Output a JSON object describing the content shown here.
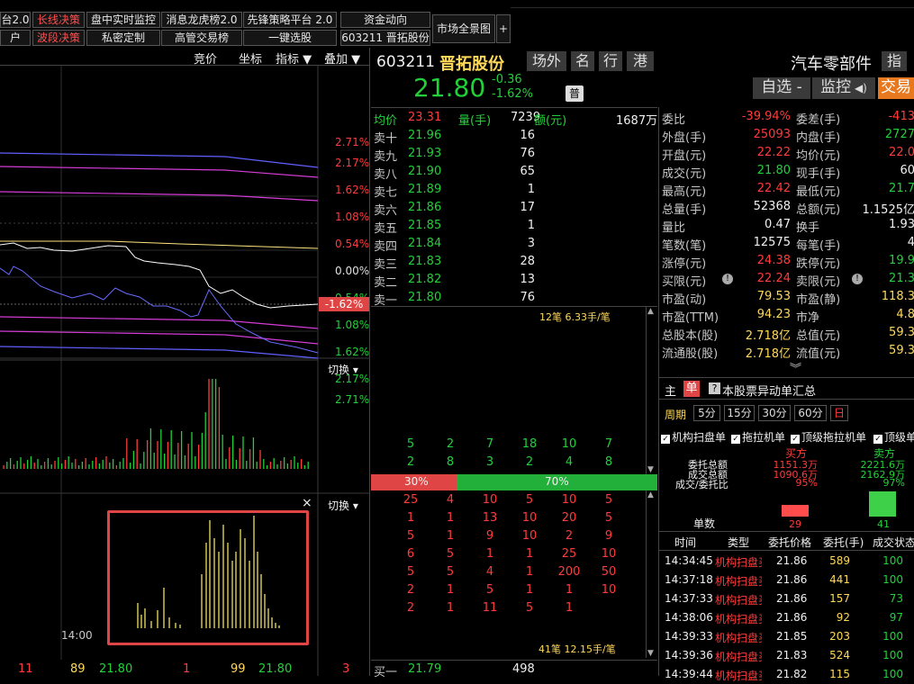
{
  "toolbar": {
    "row1": [
      "台2.0",
      "长线决策",
      "盘中实时监控",
      "消息龙虎榜2.0",
      "先锋策略平台 2.0",
      "资金动向"
    ],
    "row2": [
      "户",
      "波段决策",
      "私密定制",
      "高管交易榜",
      "一键选股",
      "603211 晋拓股份"
    ],
    "market": "市场全景图",
    "plus": "+"
  },
  "chart_tabs": [
    "竞价",
    "坐标",
    "指标 ▼",
    "叠加 ▼"
  ],
  "price_axis": [
    "2.71%",
    "2.17%",
    "1.62%",
    "1.08%",
    "0.54%",
    "0.00%",
    "0.54%",
    "1.08%",
    "1.62%",
    "2.17%",
    "2.71%"
  ],
  "current_tag": "-1.62%",
  "switch1": "切换 ▾",
  "switch2": "切换 ▾",
  "close_x": "×",
  "time_label": "14:00",
  "bottom_ticker": [
    "11",
    "89",
    "21.80",
    "1",
    "99",
    "21.80",
    "3"
  ],
  "header": {
    "code": "603211",
    "name": "晋拓股份",
    "tabs": [
      "场外",
      "名",
      "行",
      "港"
    ],
    "industry": "汽车零部件",
    "index_btn": "指",
    "price": "21.80",
    "change": "-0.36",
    "pct": "-1.62%",
    "badge": "普",
    "zixuan": "自选 -",
    "jiankong": "监控",
    "jiaoyi": "交易"
  },
  "avg": {
    "label": "均价",
    "value": "23.31",
    "vol_label": "量(手)",
    "vol": "7239",
    "amt_label": "额(元)",
    "amt": "1687万"
  },
  "asks": [
    [
      "卖十",
      "21.96",
      "16"
    ],
    [
      "卖九",
      "21.93",
      "76"
    ],
    [
      "卖八",
      "21.90",
      "65"
    ],
    [
      "卖七",
      "21.89",
      "1"
    ],
    [
      "卖六",
      "21.86",
      "17"
    ],
    [
      "卖五",
      "21.85",
      "1"
    ],
    [
      "卖四",
      "21.84",
      "3"
    ],
    [
      "卖三",
      "21.83",
      "28"
    ],
    [
      "卖二",
      "21.82",
      "13"
    ],
    [
      "卖一",
      "21.80",
      "76"
    ]
  ],
  "bid1": [
    "买一",
    "21.79",
    "498"
  ],
  "queue_top": "12笔 6.33手/笔",
  "queue_bottom": "41笔 12.15手/笔",
  "queue_sell": [
    [
      "5",
      "2",
      "7",
      "18",
      "10",
      "7"
    ],
    [
      "2",
      "8",
      "3",
      "2",
      "4",
      "8"
    ]
  ],
  "ratio": {
    "left": "30%",
    "right": "70%",
    "left_frac": 0.3
  },
  "queue_buy": [
    [
      "25",
      "4",
      "10",
      "5",
      "10",
      "5"
    ],
    [
      "1",
      "1",
      "13",
      "10",
      "20",
      "5"
    ],
    [
      "5",
      "1",
      "9",
      "10",
      "2",
      "9"
    ],
    [
      "6",
      "5",
      "1",
      "1",
      "25",
      "10"
    ],
    [
      "5",
      "5",
      "4",
      "1",
      "200",
      "50"
    ],
    [
      "2",
      "1",
      "5",
      "1",
      "1",
      "10"
    ],
    [
      "2",
      "1",
      "11",
      "5",
      "1",
      ""
    ]
  ],
  "stats": [
    [
      "委比",
      "-39.94%",
      "red",
      "委差(手)",
      "-413",
      "red"
    ],
    [
      "外盘(手)",
      "25093",
      "red",
      "内盘(手)",
      "2727",
      "green"
    ],
    [
      "开盘(元)",
      "22.22",
      "red",
      "均价(元)",
      "22.0",
      "red"
    ],
    [
      "成交(元)",
      "21.80",
      "green",
      "现手(手)",
      "60",
      "white"
    ],
    [
      "最高(元)",
      "22.42",
      "red",
      "最低(元)",
      "21.7",
      "green"
    ],
    [
      "总量(手)",
      "52368",
      "white",
      "总额(元)",
      "1.1525亿",
      "white"
    ],
    [
      "量比",
      "0.47",
      "white",
      "换手",
      "1.93",
      "white"
    ],
    [
      "笔数(笔)",
      "12575",
      "white",
      "每笔(手)",
      "4",
      "white"
    ],
    [
      "涨停(元)",
      "24.38",
      "red",
      "跌停(元)",
      "19.9",
      "green"
    ],
    [
      "买限(元)",
      "22.24",
      "red",
      "卖限(元)",
      "21.3",
      "green"
    ],
    [
      "市盈(动)",
      "79.53",
      "yellow",
      "市盈(静)",
      "118.3",
      "yellow"
    ],
    [
      "市盈(TTM)",
      "94.23",
      "yellow",
      "市净",
      "4.8",
      "yellow"
    ],
    [
      "总股本(股)",
      "2.718亿",
      "yellow",
      "总值(元)",
      "59.3",
      "yellow"
    ],
    [
      "流通股(股)",
      "2.718亿",
      "yellow",
      "流值(元)",
      "59.3",
      "yellow"
    ]
  ],
  "expand": "︾",
  "bottom_tabs": {
    "main": "主",
    "single": "单",
    "title": "本股票异动单汇总"
  },
  "period": {
    "label": "周期",
    "options": [
      "5分",
      "15分",
      "30分",
      "60分",
      "日"
    ]
  },
  "checks": [
    "机构扫盘单",
    "拖拉机单",
    "顶级拖拉机单",
    "顶级单"
  ],
  "summary": {
    "rows": [
      "委托总额",
      "成交总额",
      "成交/委托比"
    ],
    "buy_head": "买方",
    "sell_head": "卖方",
    "buy": [
      "1151.3万",
      "1090.6万",
      "95%"
    ],
    "sell": [
      "2221.6万",
      "2162.9万",
      "97%"
    ],
    "count_label": "单数",
    "buy_count": "29",
    "sell_count": "41",
    "buy_bar": 0.45,
    "sell_bar": 1.0
  },
  "trades_head": [
    "时间",
    "类型",
    "委托价格",
    "委托(手)",
    "成交状态"
  ],
  "trades": [
    [
      "14:34:45",
      "机构扫盘买",
      "21.86",
      "589",
      "100"
    ],
    [
      "14:37:18",
      "机构扫盘买",
      "21.86",
      "441",
      "100"
    ],
    [
      "14:37:33",
      "机构扫盘买",
      "21.86",
      "157",
      "73"
    ],
    [
      "14:38:06",
      "机构扫盘买",
      "21.86",
      "92",
      "97"
    ],
    [
      "14:39:33",
      "机构扫盘买",
      "21.85",
      "203",
      "100"
    ],
    [
      "14:39:36",
      "机构扫盘买",
      "21.83",
      "524",
      "100"
    ],
    [
      "14:39:44",
      "机构扫盘买",
      "21.82",
      "115",
      "100"
    ]
  ],
  "colors": {
    "red": "#ff3b3b",
    "green": "#22d03a",
    "yellow": "#ffd95a",
    "blue": "#6fa8ff",
    "orange": "#e8781e",
    "magenta": "#d63cd6",
    "price": "#ffffff",
    "avgline": "#ffe680"
  }
}
